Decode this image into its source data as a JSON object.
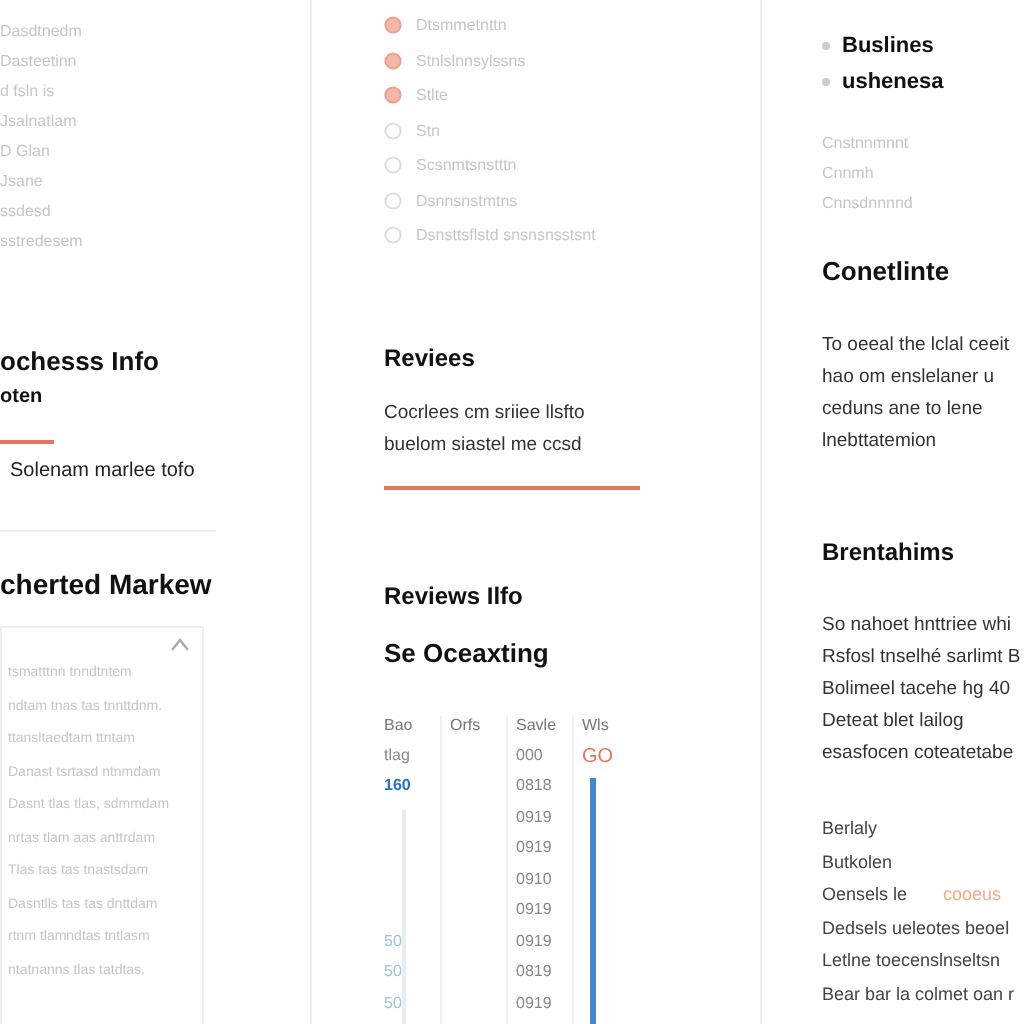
{
  "left": {
    "nav_items": [
      "Dasdtnedm",
      "Dasteetinn",
      "d fsln      is",
      "Jsalnatlam",
      "D Glan",
      "Jsane",
      "ssdesd",
      "sstredesem"
    ],
    "section_title": "ochesss Info",
    "section_subtitle": "oten",
    "link": "Solenam marlee tofo",
    "market_title": "cherted Markew",
    "panel_lines": [
      "tsmatttnn tnndtntem",
      "ndtam tnas tas tnnttdnm.",
      "ttansltaedtam ttntam",
      "Danast tsrtasd ntnmdam",
      "Dasnt tlas tlas, sdmmdam",
      "nrtas tlam aas anttrdam",
      "Tlas tas tas tnastsdam",
      "Dasntlls tas tas dnttdam",
      "rtnm tlamndtas tntlasm",
      "ntatnanns tlas tatdtas."
    ]
  },
  "middle": {
    "nav_items": [
      {
        "label": "Dtsmmetnttn",
        "active": true
      },
      {
        "label": "Stnlslnnsylssns",
        "active": true
      },
      {
        "label": "Stlte",
        "active": true
      },
      {
        "label": "Stn",
        "active": false
      },
      {
        "label": "Scsnmtsnstttn",
        "active": false
      },
      {
        "label": "Dsnnsnstmtns",
        "active": false
      },
      {
        "label": "Dsnsttsflstd snsnsnsstsnt",
        "active": false
      }
    ],
    "title": "Reviees",
    "paragraph": "Cocrlees cm sriiee llsfto buelom siastel me ccsd",
    "section_title": "Reviews Ilfo",
    "sub_title": "Se Oceaxting",
    "table": {
      "columns": [
        "Bao",
        "Orfs",
        "Savle",
        "Wls"
      ],
      "rows": [
        [
          "tlag",
          "",
          "000",
          "GO"
        ],
        [
          "160",
          "",
          "0818",
          ""
        ],
        [
          "",
          "",
          "0919",
          ""
        ],
        [
          "",
          "",
          "0919",
          ""
        ],
        [
          "",
          "",
          "0910",
          ""
        ],
        [
          "",
          "",
          "0919",
          ""
        ],
        [
          "50",
          "",
          "0919",
          ""
        ],
        [
          "50",
          "",
          "0819",
          ""
        ],
        [
          "50",
          "",
          "0919",
          ""
        ]
      ]
    }
  },
  "right": {
    "bullets": [
      "Buslines",
      "ushenesa"
    ],
    "nav_items": [
      "Cnstnnmnnt",
      "Cnnmh",
      "Cnnsdnnnnd"
    ],
    "title": "Conetlinte",
    "paragraph": "To oeeal the lclal ceeit hao om enslelaner u ceduns ane to lene lnebttatemion",
    "title2": "Brentahims",
    "paragraph2": "So nahoet hnttriee whi Rsfosl tnselhé sarlimt B Bolimeel tacehe hg 40 Deteat blet lailog esasfocen coteatetabe",
    "lines": [
      {
        "text": "Berlaly"
      },
      {
        "text": "Butkolen"
      },
      {
        "text": "Oensels le",
        "tag": "cooeus"
      },
      {
        "text": "Dedsels ueleotes beoel"
      },
      {
        "text": "Letlne toecenslnseltsn"
      },
      {
        "text": "Bear bar la colmet oan r"
      }
    ]
  }
}
